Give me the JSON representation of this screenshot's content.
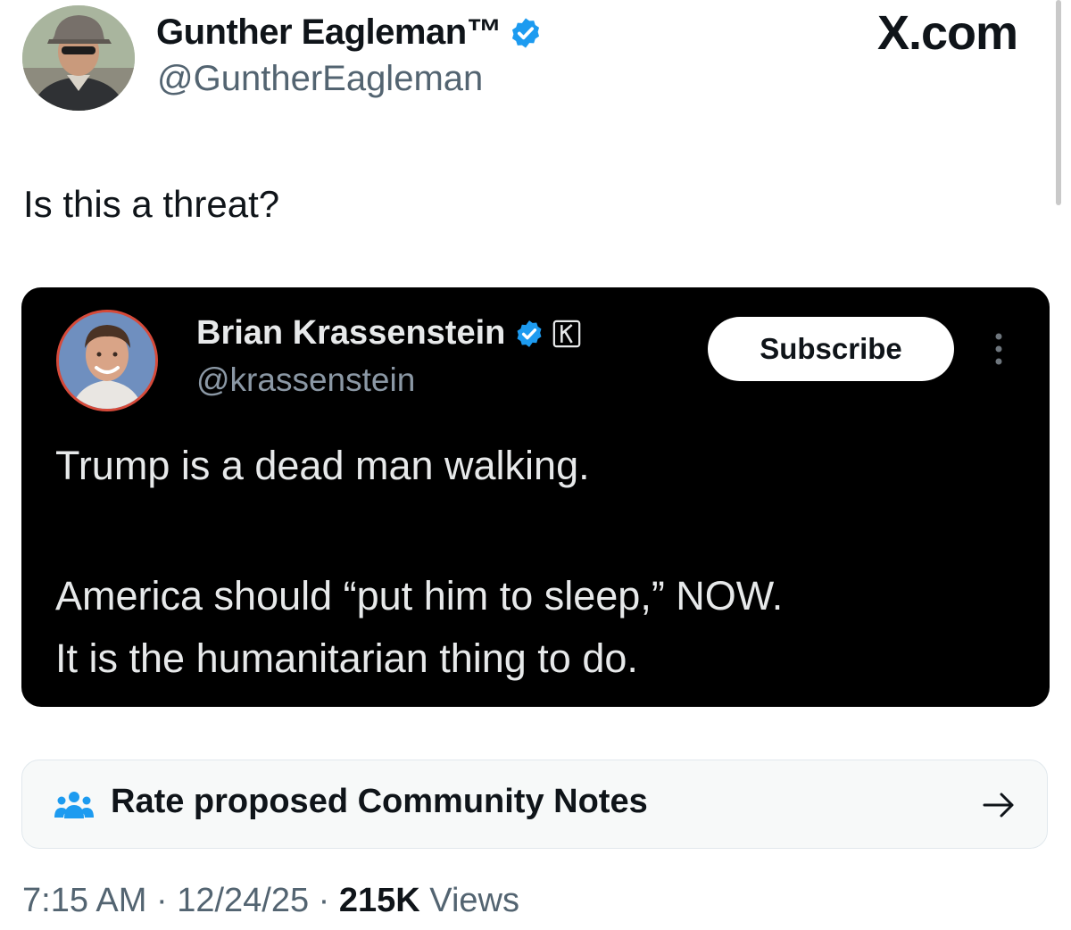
{
  "watermark": "X.com",
  "author": {
    "name": "Gunther Eagleman™",
    "handle": "@GuntherEagleman",
    "verified_icon": "verified-check-icon"
  },
  "tweet": {
    "text": "Is this a threat?"
  },
  "quoted": {
    "name": "Brian Krassenstein",
    "handle": "@krassenstein",
    "subscribe_label": "Subscribe",
    "badge_icon": "k-affiliate-icon",
    "more_icon": "more-options-icon",
    "lines": [
      "Trump is a dead man walking.",
      "America should “put him to sleep,” NOW.",
      "It is the humanitarian thing to do."
    ]
  },
  "community_notes": {
    "label": "Rate proposed Community Notes",
    "icon": "community-people-icon",
    "arrow_icon": "arrow-right-icon"
  },
  "meta": {
    "time": "7:15 AM",
    "sep1": " · ",
    "date": "12/24/25",
    "sep2": " · ",
    "views_count": "215K",
    "views_label": " Views"
  },
  "colors": {
    "verified_blue": "#1d9bf0",
    "quote_bg": "#000000",
    "secondary_text": "#536471"
  }
}
